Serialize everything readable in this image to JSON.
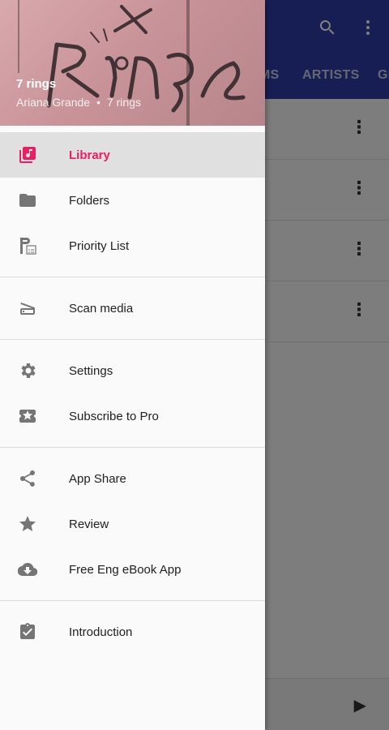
{
  "background": {
    "tabs": [
      "MS",
      "ARTISTS",
      "GE"
    ],
    "icons": [
      "search-icon",
      "more-vert-icon",
      "play-icon"
    ]
  },
  "drawer": {
    "header": {
      "title": "7 rings",
      "artist": "Ariana Grande",
      "separator": "•",
      "album": "7 rings"
    },
    "items": [
      {
        "label": "Library",
        "icon": "library-music-icon"
      },
      {
        "label": "Folders",
        "icon": "folder-icon"
      },
      {
        "label": "Priority List",
        "icon": "priority-list-icon"
      },
      {
        "label": "Scan media",
        "icon": "scan-icon"
      },
      {
        "label": "Settings",
        "icon": "gear-icon"
      },
      {
        "label": "Subscribe to Pro",
        "icon": "ticket-icon"
      },
      {
        "label": "App Share",
        "icon": "share-icon"
      },
      {
        "label": "Review",
        "icon": "star-icon"
      },
      {
        "label": "Free Eng eBook App",
        "icon": "cloud-download-icon"
      },
      {
        "label": "Introduction",
        "icon": "clipboard-check-icon"
      }
    ]
  },
  "colors": {
    "accent": "#e91e63",
    "appbar": "#2f3da6"
  }
}
